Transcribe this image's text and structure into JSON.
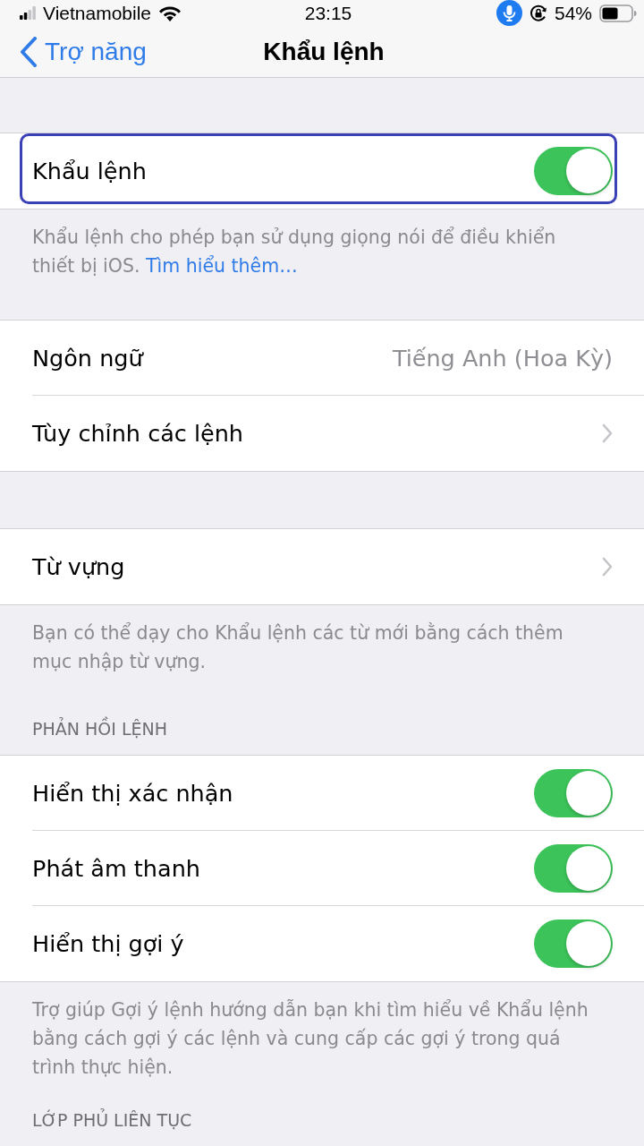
{
  "status_bar": {
    "carrier": "Vietnamobile",
    "time": "23:15",
    "battery": "54%"
  },
  "nav_bar": {
    "back": "Trợ năng",
    "title": "Khẩu lệnh"
  },
  "sections": [
    {
      "rows": [
        {
          "kind": "toggle",
          "label": "Khẩu lệnh",
          "on": true,
          "focused": true
        }
      ],
      "footer": {
        "text": "Khẩu lệnh cho phép bạn sử dụng giọng nói để điều khiển thiết bị iOS.",
        "link": "Tìm hiểu thêm…"
      }
    },
    {
      "rows": [
        {
          "kind": "value",
          "label": "Ngôn ngữ",
          "value": "Tiếng Anh (Hoa Kỳ)",
          "focused": false
        },
        {
          "kind": "link",
          "label": "Tùy chỉnh các lệnh",
          "focused": false
        }
      ]
    },
    {
      "rows": [
        {
          "kind": "link",
          "label": "Từ vựng",
          "focused": false
        }
      ],
      "footer": {
        "text": "Bạn có thể dạy cho Khẩu lệnh các từ mới bằng cách thêm mục nhập từ vựng."
      }
    },
    {
      "header": "PHẢN HỒI LỆNH",
      "rows": [
        {
          "kind": "toggle",
          "label": "Hiển thị xác nhận",
          "on": true,
          "focused": false
        },
        {
          "kind": "toggle",
          "label": "Phát âm thanh",
          "on": true,
          "focused": false
        },
        {
          "kind": "toggle",
          "label": "Hiển thị gợi ý",
          "on": true,
          "focused": false
        }
      ],
      "footer": {
        "text": "Trợ giúp Gợi ý lệnh hướng dẫn bạn khi tìm hiểu về Khẩu lệnh bằng cách gợi ý các lệnh và cung cấp các gợi ý trong quá trình thực hiện."
      }
    },
    {
      "header": "LỚP PHỦ LIÊN TỤC"
    }
  ]
}
